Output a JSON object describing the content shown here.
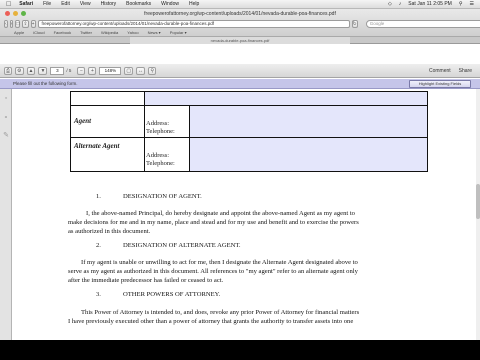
{
  "menubar": {
    "app": "Safari",
    "items": [
      "File",
      "Edit",
      "View",
      "History",
      "Bookmarks",
      "Window",
      "Help"
    ],
    "clock": "Sat Jan 11  2:05 PM"
  },
  "window": {
    "title": "freepowerofattorney.org/wp-content/uploads/2014/01/nevada-durable-poa-finances.pdf",
    "url": "freepowerofattorney.org/wp-content/uploads/2014/01/nevada-durable-poa-finances.pdf",
    "search_placeholder": "Google",
    "bookmarks": [
      "Apple",
      "iCloud",
      "Facebook",
      "Twitter",
      "Wikipedia",
      "Yahoo",
      "News ▾",
      "Popular ▾"
    ],
    "tab_title": "nevada-durable-poa-finances.pdf"
  },
  "pdf_toolbar": {
    "page_current": "3",
    "page_total": "/ 5",
    "zoom": "148%",
    "comment": "Comment",
    "share": "Share"
  },
  "form_bar": {
    "message": "Please fill out the following form.",
    "highlight_button": "Highlight Existing Fields"
  },
  "form_table": {
    "rows": [
      {
        "label": "",
        "info": ""
      },
      {
        "label": "Agent",
        "info": "Address:\nTelephone:"
      },
      {
        "label": "Alternate Agent",
        "info": "Address:\nTelephone:"
      }
    ]
  },
  "document": {
    "sections": [
      {
        "number": "1.",
        "heading": "DESIGNATION OF AGENT.",
        "lines": [
          "I, the above-named Principal, do hereby designate and appoint the above-named Agent as my agent to",
          "make decisions for me and in my name, place and stead and for my use and benefit and to exercise the powers",
          "as authorized in this document."
        ]
      },
      {
        "number": "2.",
        "heading": "DESIGNATION OF ALTERNATE AGENT.",
        "lines": [
          "If my agent is unable or unwilling to act for me, then I designate the Alternate Agent designated above to",
          "serve as my agent as authorized in this document.  All references to \"my agent\" refer to an alternate agent only",
          "after the immediate predecessor has failed or ceased to act."
        ]
      },
      {
        "number": "3.",
        "heading": "OTHER POWERS OF ATTORNEY.",
        "lines": [
          "This Power of Attorney is intended to, and does, revoke any prior Power of Attorney for financial matters",
          "I have previously executed other than a power of attorney that grants the authority to transfer assets into one"
        ]
      }
    ]
  }
}
